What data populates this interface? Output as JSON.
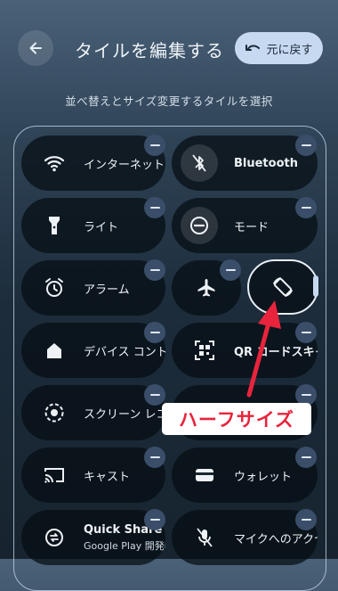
{
  "header": {
    "title": "タイルを編集する",
    "undo_label": "元に戻す"
  },
  "subtitle": "並べ替えとサイズ変更するタイルを選択",
  "tiles": {
    "internet": "インターネット",
    "bluetooth": "Bluetooth",
    "light": "ライト",
    "mode": "モード",
    "alarm": "アラーム",
    "device": "デバイス コントロール",
    "qr": "QR コードスキャナー",
    "screen": "スクリーン レコード",
    "cast": "キャスト",
    "wallet": "ウォレット",
    "quickshare_title": "Quick Share",
    "quickshare_sub": "Google Play 開発者",
    "mic": "マイクへのアクセス"
  },
  "annotation": "ハーフサイズ",
  "colors": {
    "accent": "#c7d9f0",
    "annotation_text": "#e8243c",
    "arrow": "#e8243c"
  }
}
